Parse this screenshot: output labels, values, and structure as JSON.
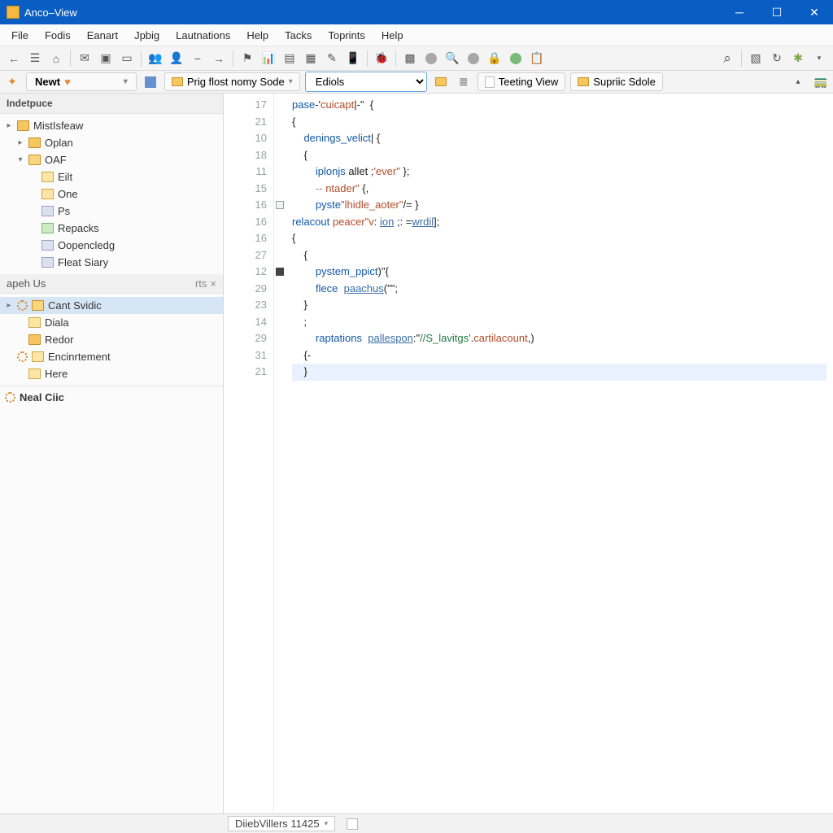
{
  "window": {
    "title": "Anco–View"
  },
  "menu": [
    "File",
    "Fodis",
    "Eanart",
    "Jpbig",
    "Lautnations",
    "Help",
    "Tacks",
    "Toprints",
    "Help"
  ],
  "bookmark": {
    "label": "Newt"
  },
  "tabs": {
    "primary": "Prig flost nomy Sode",
    "selector": "Ediols",
    "secondary": "Teeting View",
    "tertiary": "Supriic Sdole"
  },
  "panels": {
    "projects": {
      "header": "Indetpuce",
      "items": [
        {
          "label": "MistIsfeaw",
          "icon": "folder",
          "indent": 0,
          "twist": "▸"
        },
        {
          "label": "Oplan",
          "icon": "folder",
          "indent": 1,
          "twist": "▸"
        },
        {
          "label": "OAF",
          "icon": "folder-open",
          "indent": 1,
          "twist": "▾"
        },
        {
          "label": "Eilt",
          "icon": "file-y",
          "indent": 2,
          "twist": ""
        },
        {
          "label": "One",
          "icon": "file-y",
          "indent": 2,
          "twist": ""
        },
        {
          "label": "Ps",
          "icon": "db",
          "indent": 2,
          "twist": ""
        },
        {
          "label": "Repacks",
          "icon": "file-g",
          "indent": 2,
          "twist": ""
        },
        {
          "label": "Oopencledg",
          "icon": "db",
          "indent": 2,
          "twist": ""
        },
        {
          "label": "Fleat Siary",
          "icon": "db",
          "indent": 2,
          "twist": ""
        }
      ]
    },
    "graph": {
      "header": "apeh Us",
      "header_right": [
        "rts",
        "×"
      ],
      "items": [
        {
          "label": "Cant Svidic",
          "icon": "folder-open",
          "indent": 0,
          "twist": "▸",
          "gear": true,
          "sel": true
        },
        {
          "label": "Diala",
          "icon": "file-y",
          "indent": 1,
          "twist": ""
        },
        {
          "label": "Redor",
          "icon": "folder",
          "indent": 1,
          "twist": ""
        },
        {
          "label": "Encinrtement",
          "icon": "file-y",
          "indent": 0,
          "twist": "",
          "gear": true
        },
        {
          "label": "Here",
          "icon": "file-y",
          "indent": 1,
          "twist": ""
        }
      ]
    },
    "neal": {
      "label": "Neal Ciic"
    }
  },
  "editor": {
    "line_numbers": [
      "17",
      "21",
      "10",
      "18",
      "11",
      "15",
      "16",
      "16",
      "16",
      "27",
      "12",
      "29",
      "23",
      "14",
      "29",
      "31",
      "21"
    ],
    "margins": [
      "",
      "",
      "",
      "",
      "",
      "",
      "box",
      "",
      "",
      "",
      "box-dark",
      "",
      "",
      "",
      "",
      "",
      ""
    ],
    "code": [
      [
        [
          "kw",
          "pase"
        ],
        [
          "p",
          "-'"
        ],
        [
          "lit",
          "cuicapt"
        ],
        [
          "p",
          "|-\"  {"
        ]
      ],
      [
        [
          "p",
          "{"
        ]
      ],
      [
        [
          "p",
          "    "
        ],
        [
          "kw",
          "denings_velict"
        ],
        [
          "p",
          "| {"
        ]
      ],
      [
        [
          "p",
          "    {"
        ]
      ],
      [
        [
          "p",
          "        "
        ],
        [
          "kw",
          "iplonjs"
        ],
        [
          "p",
          " allet ;"
        ],
        [
          "lit",
          "'ever\""
        ],
        [
          "p",
          " };"
        ]
      ],
      [
        [
          "p",
          "        "
        ],
        [
          "cm",
          "-- "
        ],
        [
          "lit",
          "ntader\""
        ],
        [
          "p",
          " {,"
        ]
      ],
      [
        [
          "p",
          "        "
        ],
        [
          "kw",
          "pyste"
        ],
        [
          "lit",
          "\"lhidle_aoter\""
        ],
        [
          "p",
          "/= }"
        ]
      ],
      [
        [
          "kw",
          "relacout"
        ],
        [
          "p",
          " "
        ],
        [
          "lit",
          "peacer\"v"
        ],
        [
          "p",
          ": "
        ],
        [
          "fn",
          "ion"
        ],
        [
          "p",
          " ;: ="
        ],
        [
          "fn",
          "wrdil"
        ],
        [
          "p",
          "];"
        ]
      ],
      [
        [
          "p",
          "{"
        ]
      ],
      [
        [
          "p",
          "    {"
        ]
      ],
      [
        [
          "p",
          "        "
        ],
        [
          "kw",
          "pystem_ppict"
        ],
        [
          "p",
          ")\"{"
        ]
      ],
      [
        [
          "p",
          "        "
        ],
        [
          "kw",
          "flece"
        ],
        [
          "p",
          "  "
        ],
        [
          "fn",
          "paachus"
        ],
        [
          "p",
          "(\"\";"
        ]
      ],
      [
        [
          "p",
          "    }"
        ]
      ],
      [
        [
          "p",
          "    ;"
        ]
      ],
      [
        [
          "p",
          "        "
        ],
        [
          "kw",
          "raptations"
        ],
        [
          "p",
          "  "
        ],
        [
          "fn",
          "pallespon"
        ],
        [
          "p",
          ":\""
        ],
        [
          "str",
          "//S_lavitgs'"
        ],
        [
          "p",
          "."
        ],
        [
          "lit",
          "cartilacount"
        ],
        [
          "p",
          ",)"
        ]
      ],
      [
        [
          "p",
          "    {-"
        ]
      ],
      [
        [
          "p",
          "    }"
        ]
      ]
    ],
    "highlight_line": 16
  },
  "status": {
    "label": "DiiebVillers 11425"
  }
}
